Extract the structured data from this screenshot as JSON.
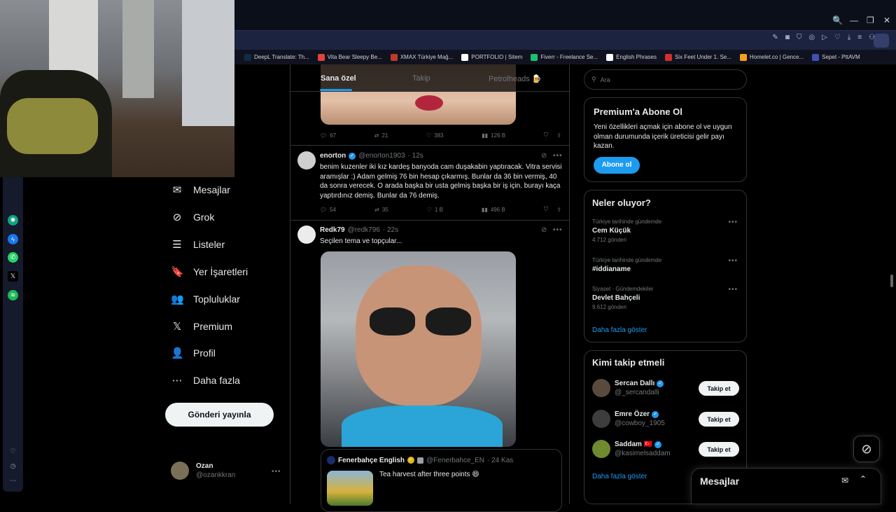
{
  "browser": {
    "window_controls": [
      "🔍",
      "—",
      "❐",
      "✕"
    ],
    "bookmarks": [
      {
        "label": "DeepL Translate: Th...",
        "color": "#0f2b46"
      },
      {
        "label": "Vita Bear Sleepy Be...",
        "color": "#e0433a"
      },
      {
        "label": "XMAX Türkiye Mağ...",
        "color": "#c0392b"
      },
      {
        "label": "PORTFOLIO | Sitem",
        "color": "#ffffff"
      },
      {
        "label": "Fiverr - Freelance Se...",
        "color": "#1dbf73"
      },
      {
        "label": "English Phrases",
        "color": "#ffffff"
      },
      {
        "label": "Six Feet Under 1. Se...",
        "color": "#d32f2f"
      },
      {
        "label": "Homelet.co | Gence...",
        "color": "#f4a21b"
      },
      {
        "label": "Sepet - PttAVM",
        "color": "#3f51b5"
      }
    ]
  },
  "nav": {
    "items": [
      {
        "label": "Mesajlar",
        "icon": "✉"
      },
      {
        "label": "Grok",
        "icon": "⊘"
      },
      {
        "label": "Listeler",
        "icon": "☰"
      },
      {
        "label": "Yer İşaretleri",
        "icon": "🔖"
      },
      {
        "label": "Topluluklar",
        "icon": "👥"
      },
      {
        "label": "Premium",
        "icon": "𝕏"
      },
      {
        "label": "Profil",
        "icon": "👤"
      },
      {
        "label": "Daha fazla",
        "icon": "⋯"
      }
    ],
    "post_button": "Gönderi yayınla",
    "profile": {
      "name": "Ozan",
      "handle": "@ozankkran"
    }
  },
  "tabs": [
    "Sana özel",
    "Takip",
    "Petrolheads 🍺"
  ],
  "tweets": [
    {
      "actions": {
        "replies": "67",
        "retweets": "21",
        "likes": "383",
        "views": "126 B"
      }
    },
    {
      "name": "enorton",
      "handle": "@enorton1903",
      "time": "· 12s",
      "text": "benim kuzenler iki kız kardeş banyoda cam duşakabin yaptıracak. Vitra servisi aramışlar :) Adam gelmiş 76 bin hesap çıkarmış. Bunlar da 36 bin vermiş, 40 da sonra verecek. O arada başka bir usta gelmiş başka bir iş için. burayı kaça yaptırdınız demiş. Bunlar da 76 demiş.",
      "actions": {
        "replies": "54",
        "retweets": "35",
        "likes": "1 B",
        "views": "496 B"
      }
    },
    {
      "name": "Redk79",
      "handle": "@redk796",
      "time": "· 22s",
      "text": "Seçilen tema ve topçular...",
      "quote": {
        "name": "Fenerbahçe English",
        "handle": "@Fenerbahce_EN",
        "time": "· 24 Kas",
        "text": "Tea harvest after three points 😄"
      }
    }
  ],
  "search": {
    "placeholder": "Ara"
  },
  "premium": {
    "title": "Premium'a Abone Ol",
    "body": "Yeni özellikleri açmak için abone ol ve uygun olman durumunda içerik üreticisi gelir payı kazan.",
    "button": "Abone ol"
  },
  "trends": {
    "title": "Neler oluyor?",
    "items": [
      {
        "category": "Türkiye tarihinde gündemde",
        "name": "Cem Küçük",
        "count": "4.712 gönderi"
      },
      {
        "category": "Türkiye tarihinde gündemde",
        "name": "#iddianame",
        "count": ""
      },
      {
        "category": "Siyaset · Gündemdekiler",
        "name": "Devlet Bahçeli",
        "count": "9.612 gönderi"
      }
    ],
    "show_more": "Daha fazla göster"
  },
  "who_to_follow": {
    "title": "Kimi takip etmeli",
    "users": [
      {
        "name": "Sercan Dallı",
        "handle": "@_sercandalli",
        "button": "Takip et",
        "verified": true
      },
      {
        "name": "Emre Özer",
        "handle": "@cowboy_1905",
        "button": "Takip et",
        "verified": true
      },
      {
        "name": "Saddam 🇹🇷",
        "handle": "@kasimelsaddam",
        "button": "Takip et",
        "verified": true
      }
    ],
    "show_more": "Daha fazla göster"
  },
  "messages_drawer": {
    "title": "Mesajlar"
  }
}
